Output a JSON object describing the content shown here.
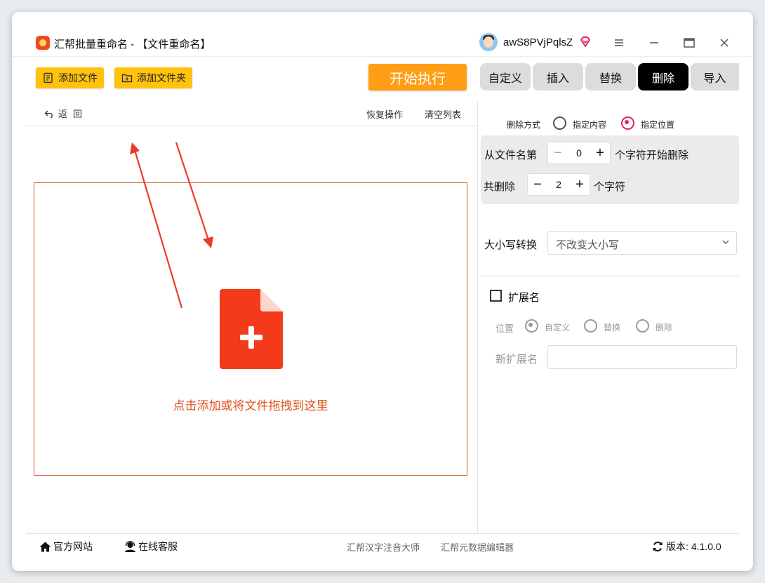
{
  "window": {
    "title": "汇帮批量重命名 - 【文件重命名】",
    "username": "awS8PVjPqlsZ"
  },
  "toolbar": {
    "add_file": "添加文件",
    "add_folder": "添加文件夹",
    "start": "开始执行"
  },
  "tabs": [
    {
      "label": "自定义",
      "active": false
    },
    {
      "label": "插入",
      "active": false
    },
    {
      "label": "替换",
      "active": false
    },
    {
      "label": "删除",
      "active": true
    },
    {
      "label": "导入",
      "active": false
    }
  ],
  "filebar": {
    "back": "返回",
    "restore": "恢复操作",
    "clear": "清空列表"
  },
  "dropzone": {
    "hint": "点击添加或将文件拖拽到这里"
  },
  "delete_panel": {
    "mode_label": "删除方式",
    "mode_options": [
      "指定内容",
      "指定位置"
    ],
    "mode_selected": "指定位置",
    "from_label": "从文件名第",
    "from_value": "0",
    "from_suffix": "个字符开始删除",
    "count_label": "共删除",
    "count_value": "2",
    "count_suffix": "个字符",
    "case_label": "大小写转换",
    "case_value": "不改变大小写"
  },
  "extension": {
    "label": "扩展名",
    "checked": false,
    "position_label": "位置",
    "position_options": [
      "自定义",
      "替换",
      "删除"
    ],
    "position_selected": "自定义",
    "new_ext_label": "新扩展名",
    "new_ext_value": ""
  },
  "footer": {
    "website": "官方网站",
    "support": "在线客服",
    "link1": "汇帮汉字注音大师",
    "link2": "汇帮元数据编辑器",
    "version_label": "版本:",
    "version_value": "4.1.0.0"
  },
  "colors": {
    "accent_yellow": "#ffc20e",
    "start_orange": "#ff9e14",
    "drop_red": "#e0541f",
    "radio_pink": "#e8245b",
    "active_tab": "#000000"
  }
}
